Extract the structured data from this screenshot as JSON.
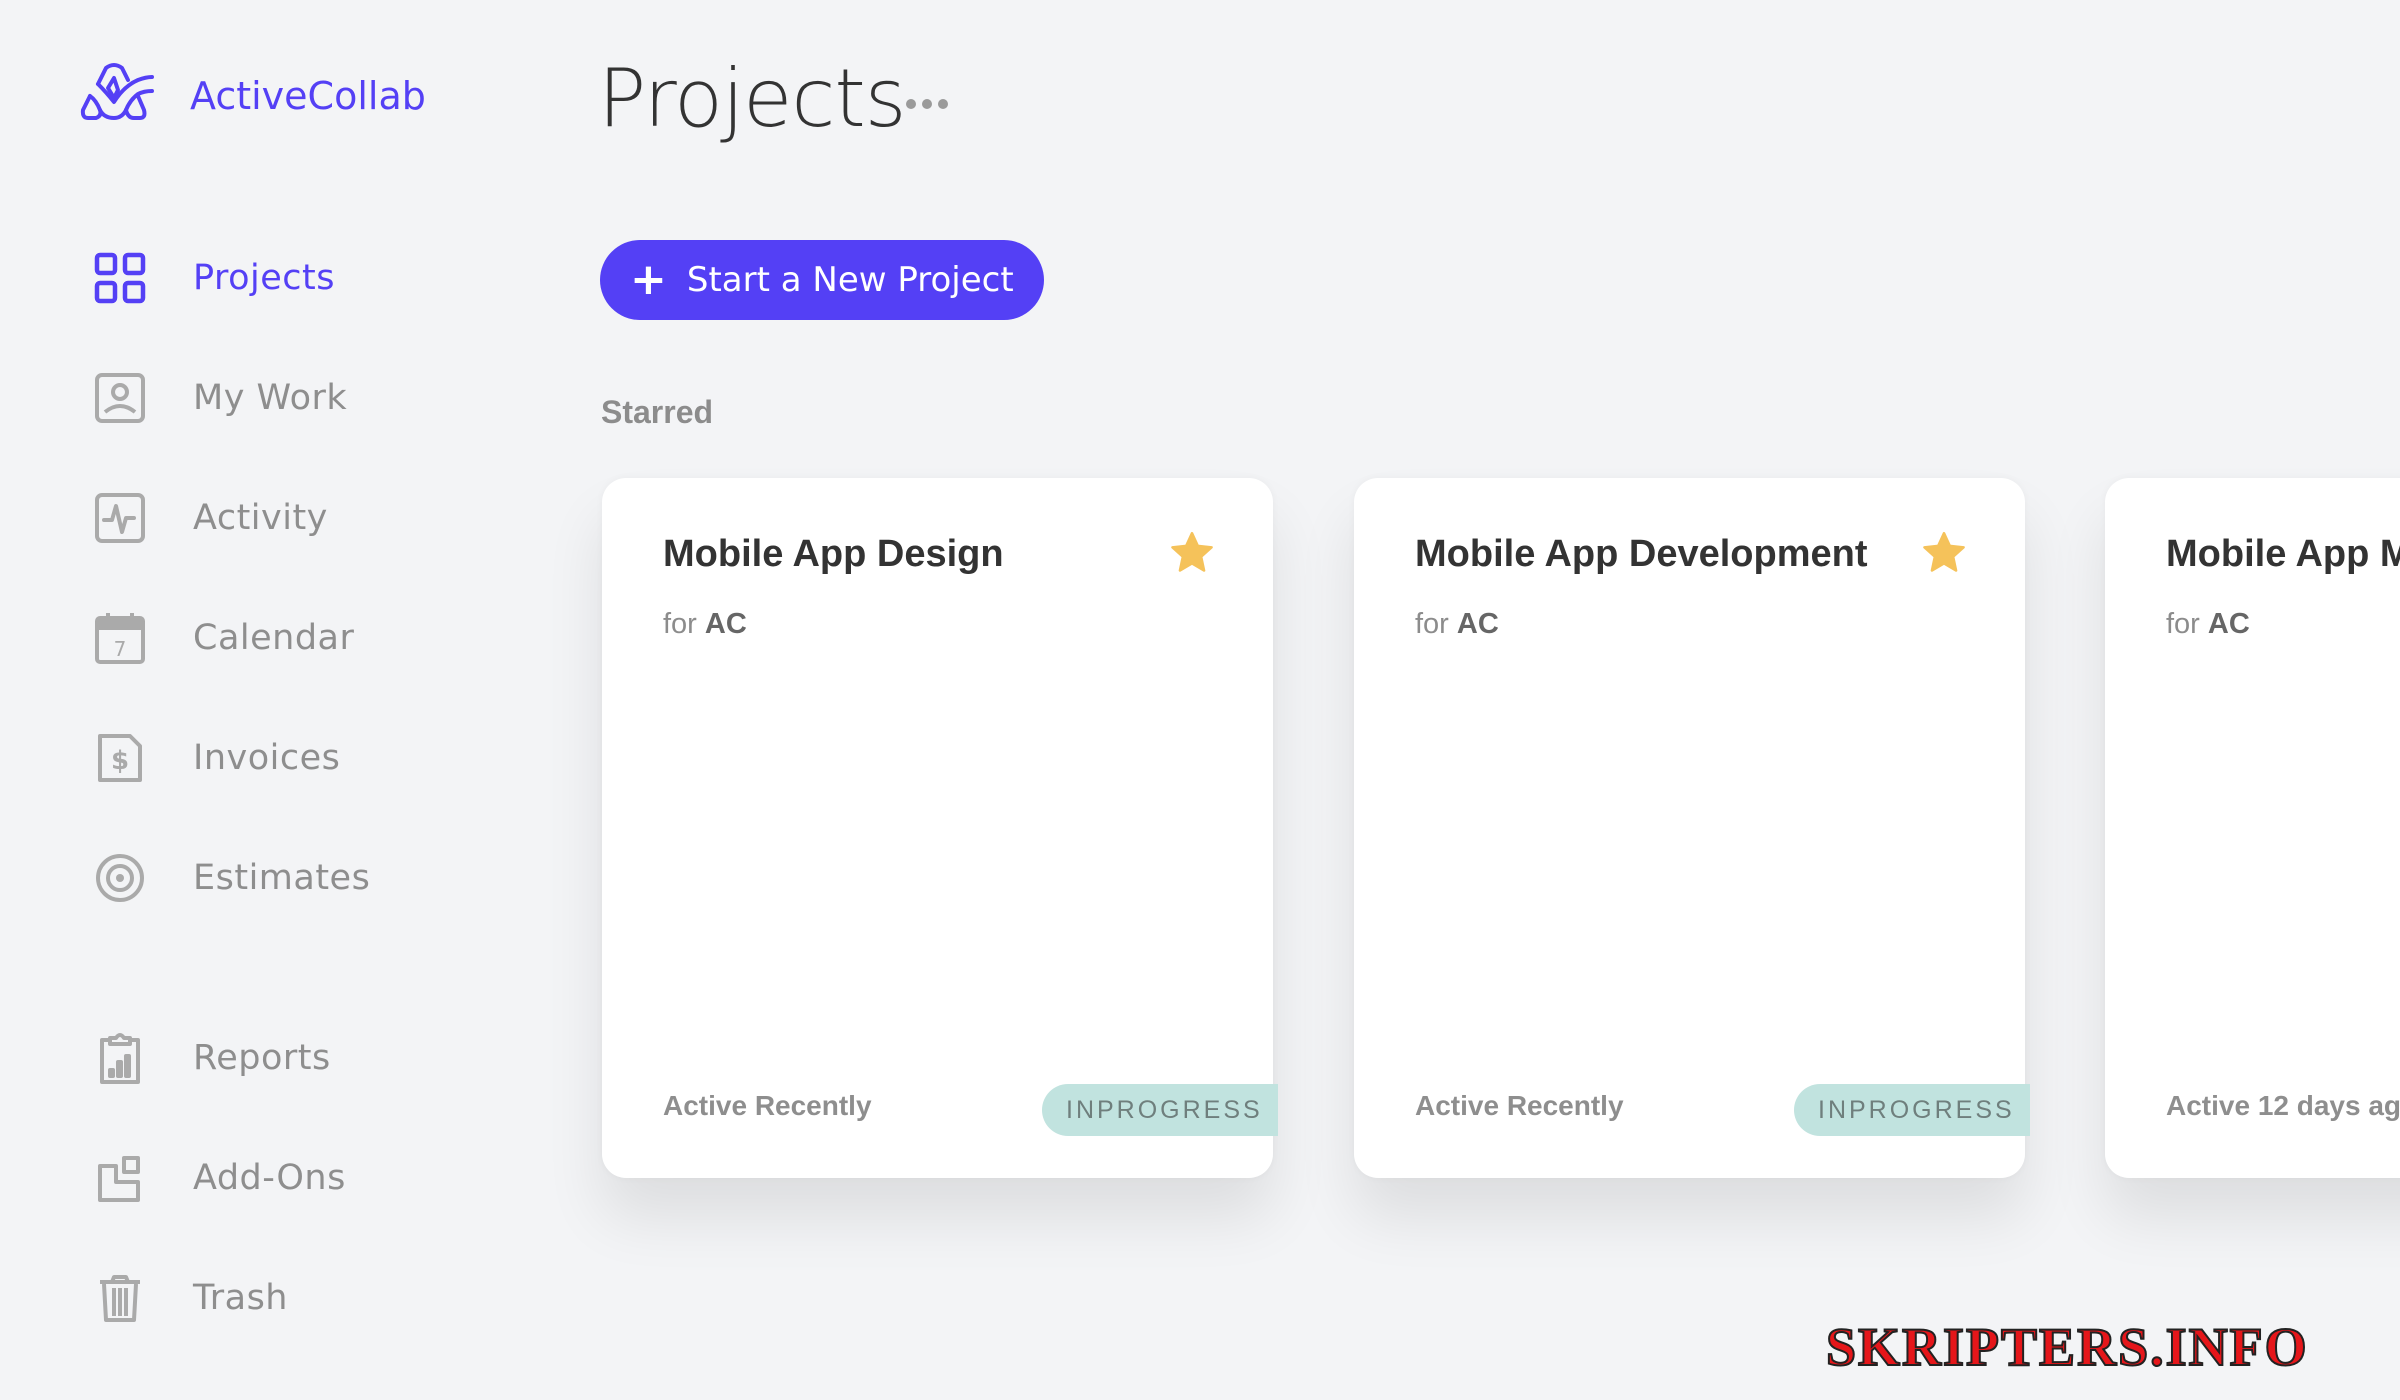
{
  "app": {
    "brand_name": "ActiveCollab",
    "brand_color": "#5440f5"
  },
  "sidebar": {
    "items": [
      {
        "label": "Projects",
        "icon": "grid-icon",
        "active": true
      },
      {
        "label": "My Work",
        "icon": "user-badge-icon",
        "active": false
      },
      {
        "label": "Activity",
        "icon": "activity-pulse-icon",
        "active": false
      },
      {
        "label": "Calendar",
        "icon": "calendar-icon",
        "active": false,
        "icon_text": "7"
      },
      {
        "label": "Invoices",
        "icon": "invoice-dollar-icon",
        "active": false
      },
      {
        "label": "Estimates",
        "icon": "target-icon",
        "active": false
      },
      {
        "label": "Reports",
        "icon": "clipboard-chart-icon",
        "active": false
      },
      {
        "label": "Add-Ons",
        "icon": "add-ons-icon",
        "active": false
      },
      {
        "label": "Trash",
        "icon": "trash-icon",
        "active": false
      }
    ]
  },
  "header": {
    "title": "Projects",
    "more_icon": "more-horizontal-icon"
  },
  "toolbar": {
    "new_project_icon": "+",
    "new_project_label": "Start a New Project"
  },
  "starred": {
    "label": "Starred",
    "projects": [
      {
        "title": "Mobile App Design",
        "client_prefix": "for",
        "client": "AC",
        "activity": "Active Recently",
        "status": "INPROGRESS",
        "starred": true
      },
      {
        "title": "Mobile App Development",
        "client_prefix": "for",
        "client": "AC",
        "activity": "Active Recently",
        "status": "INPROGRESS",
        "starred": true
      },
      {
        "title": "Mobile App M",
        "client_prefix": "for",
        "client": "AC",
        "activity": "Active 12 days ag",
        "status": null,
        "starred": null
      }
    ]
  },
  "colors": {
    "accent": "#5440f5",
    "star": "#f5c25a",
    "status_inprogress_bg": "#c1e3df",
    "background": "#f3f4f6"
  },
  "watermark": "SKRIPTERS.INFO"
}
